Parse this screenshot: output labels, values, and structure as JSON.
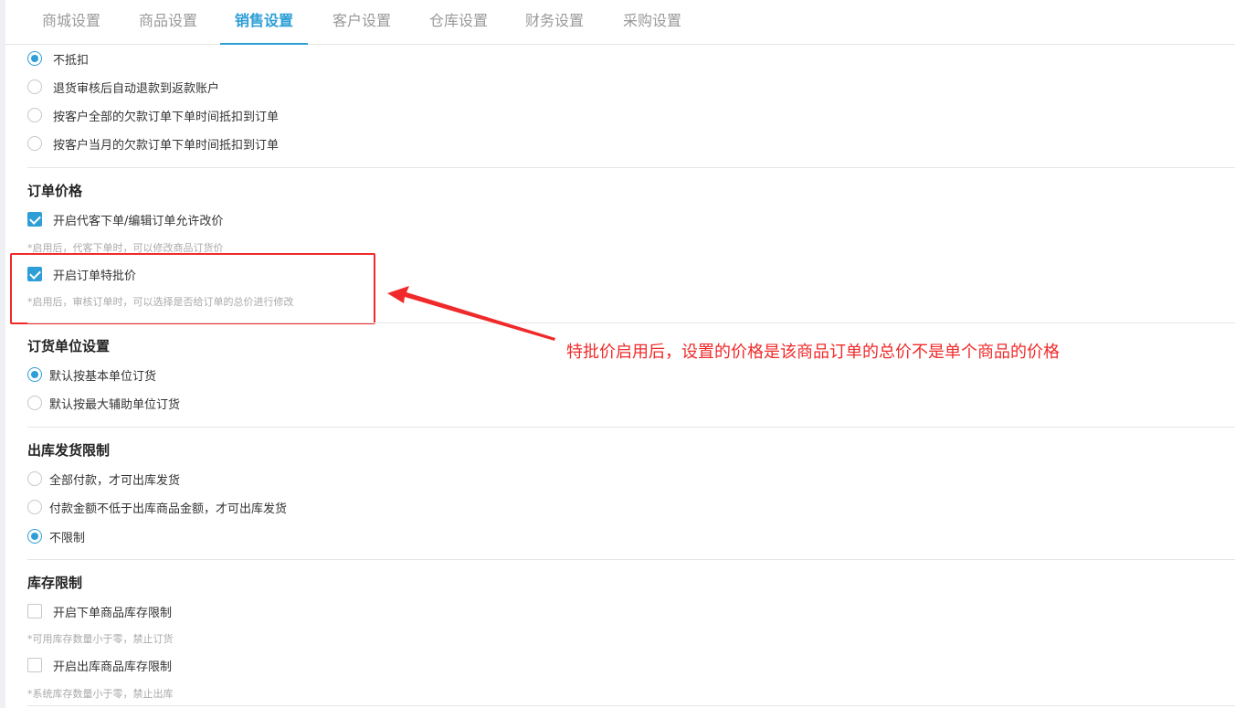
{
  "tabs": [
    {
      "label": "商城设置",
      "active": false
    },
    {
      "label": "商品设置",
      "active": false
    },
    {
      "label": "销售设置",
      "active": true
    },
    {
      "label": "客户设置",
      "active": false
    },
    {
      "label": "仓库设置",
      "active": false
    },
    {
      "label": "财务设置",
      "active": false
    },
    {
      "label": "采购设置",
      "active": false
    }
  ],
  "refund_deduction": {
    "options": [
      {
        "label": "不抵扣",
        "checked": true
      },
      {
        "label": "退货审核后自动退款到返款账户",
        "checked": false
      },
      {
        "label": "按客户全部的欠款订单下单时间抵扣到订单",
        "checked": false
      },
      {
        "label": "按客户当月的欠款订单下单时间抵扣到订单",
        "checked": false
      }
    ]
  },
  "order_price": {
    "title": "订单价格",
    "allow_modify": {
      "label": "开启代客下单/编辑订单允许改价",
      "checked": true,
      "hint": "*启用后，代客下单时，可以修改商品订货价"
    },
    "special_price": {
      "label": "开启订单特批价",
      "checked": true,
      "hint": "*启用后，审核订单时，可以选择是否给订单的总价进行修改"
    }
  },
  "order_unit": {
    "title": "订货单位设置",
    "options": [
      {
        "label": "默认按基本单位订货",
        "checked": true
      },
      {
        "label": "默认按最大辅助单位订货",
        "checked": false
      }
    ]
  },
  "shipping_limit": {
    "title": "出库发货限制",
    "options": [
      {
        "label": "全部付款，才可出库发货",
        "checked": false
      },
      {
        "label": "付款金额不低于出库商品金额，才可出库发货",
        "checked": false
      },
      {
        "label": "不限制",
        "checked": true
      }
    ]
  },
  "stock_limit": {
    "title": "库存限制",
    "order_stock": {
      "label": "开启下单商品库存限制",
      "checked": false,
      "hint": "*可用库存数量小于零，禁止订货"
    },
    "outbound_stock": {
      "label": "开启出库商品库存限制",
      "checked": false,
      "hint": "*系统库存数量小于零，禁止出库"
    }
  },
  "annotation": {
    "text": "特批价启用后，设置的价格是该商品订单的总价不是单个商品的价格",
    "color": "#f02a2a"
  },
  "colors": {
    "accent": "#2d9ed6",
    "annotation": "#f02a2a"
  }
}
